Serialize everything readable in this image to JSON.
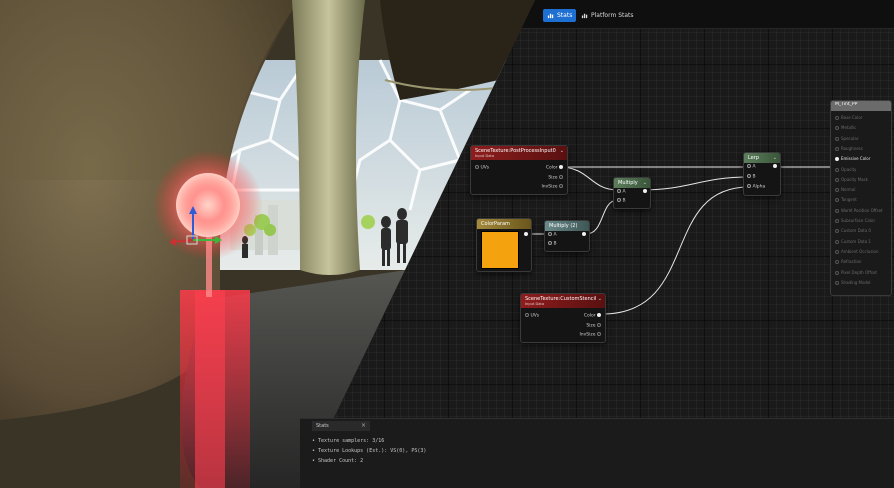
{
  "toolbar": {
    "stats_label": "Stats",
    "platform_stats_label": "Platform Stats"
  },
  "nodes": {
    "scene_tex_post": {
      "title": "SceneTexture:PostProcessInput0",
      "subtitle": "Input Data",
      "input": "UVs",
      "outputs": [
        "Color",
        "Size",
        "InvSize"
      ]
    },
    "multiply_a": {
      "title": "Multiply",
      "inputs": [
        "A",
        "B"
      ]
    },
    "color_param": {
      "title": "ColorParam",
      "swatch_color": "#f5a20f"
    },
    "multiply_b": {
      "title": "Multiply (2)",
      "inputs": [
        "A",
        "B"
      ]
    },
    "lerp": {
      "title": "Lerp",
      "inputs": [
        "A",
        "B",
        "Alpha"
      ]
    },
    "scene_tex_stencil": {
      "title": "SceneTexture:CustomStencil",
      "subtitle": "Input Data",
      "input": "UVs",
      "outputs": [
        "Color",
        "Size",
        "InvSize"
      ]
    },
    "result": {
      "title": "M_Tint_PP",
      "pins": [
        "Base Color",
        "Metallic",
        "Specular",
        "Roughness",
        "Emissive Color",
        "Opacity",
        "Opacity Mask",
        "Normal",
        "Tangent",
        "World Position Offset",
        "Subsurface Color",
        "Custom Data 0",
        "Custom Data 1",
        "Ambient Occlusion",
        "Refraction",
        "Pixel Depth Offset",
        "Shading Model"
      ],
      "active_index": 4
    }
  },
  "stats_panel": {
    "tab_label": "Stats",
    "lines": [
      "• Texture samplers: 3/16",
      "• Texture Lookups (Est.): VS(0), PS(3)",
      "• Shader Count: 2"
    ]
  },
  "colors": {
    "accent": "#1d6fd2",
    "swatch": "#f5a20f",
    "scene_texture_header": "#8e1d1d",
    "math_header": "#5d7f5d"
  }
}
